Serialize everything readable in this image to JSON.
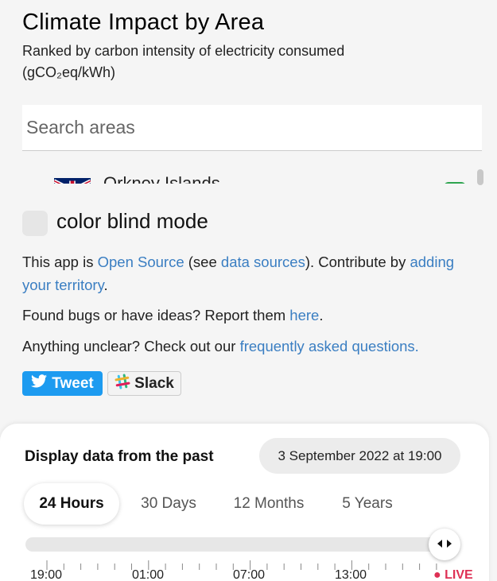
{
  "header": {
    "title": "Climate Impact by Area",
    "subtitle": "Ranked by carbon intensity of electricity consumed (gCO₂eq/kWh)"
  },
  "search": {
    "placeholder": "Search areas"
  },
  "list": {
    "items": [
      {
        "name": "Orkney Islands",
        "flag-icon": "uk-flag-icon",
        "status_color": "#2ea44f"
      }
    ]
  },
  "color_blind": {
    "label": "color blind mode"
  },
  "info": {
    "p1_pre": "This app is ",
    "p1_link1": "Open Source",
    "p1_mid": " (see ",
    "p1_link2": "data sources",
    "p1_post": "). Contribute by ",
    "p1_link3": "adding your territory",
    "p1_end": ".",
    "p2_pre": "Found bugs or have ideas? Report them ",
    "p2_link": "here",
    "p2_end": ".",
    "p3_pre": "Anything unclear? Check out our ",
    "p3_link": "frequently asked questions."
  },
  "social": {
    "tweet_label": "Tweet",
    "slack_label": "Slack",
    "tweet_color": "#1d9bf0"
  },
  "time_panel": {
    "title": "Display data from the past",
    "selected_date": "3 September 2022 at 19:00",
    "tabs": [
      "24 Hours",
      "30 Days",
      "12 Months",
      "5 Years"
    ],
    "active_tab": "24 Hours",
    "tick_labels": [
      "19:00",
      "01:00",
      "07:00",
      "13:00"
    ],
    "live_label": "LIVE",
    "live_color": "#de3054",
    "slider_position_fraction": 1.0
  }
}
